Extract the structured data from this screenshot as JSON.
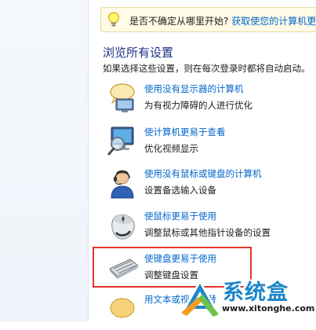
{
  "tip": {
    "text": "是否不确定从哪里开始?",
    "link": "获取使您的计算机更"
  },
  "section": {
    "title": "浏览所有设置",
    "description": "如果选择这些设置，则在每次登录时都将自动启动。"
  },
  "items": [
    {
      "link": "使用没有显示器的计算机",
      "desc": "为有视力障碍的人进行优化",
      "icon": "speech-bubble-monitor-icon"
    },
    {
      "link": "使计算机更易于查看",
      "desc": "优化视频显示",
      "icon": "monitor-magnifier-icon"
    },
    {
      "link": "使用没有鼠标或键盘的计算机",
      "desc": "设置备选输入设备",
      "icon": "headset-user-icon"
    },
    {
      "link": "使鼠标更易于使用",
      "desc": "调整鼠标或其他指针设备的设置",
      "icon": "mouse-icon"
    },
    {
      "link": "使键盘更易于使用",
      "desc": "调整键盘设置",
      "icon": "keyboard-icon"
    },
    {
      "link": "用文本或视觉代替",
      "desc": "",
      "icon": "text-visual-icon"
    }
  ],
  "watermark": {
    "brand": "系统盒",
    "url": "www.xitonghe.com"
  },
  "colors": {
    "link": "#0066cc",
    "title": "#1e3287",
    "highlight": "#e0352e",
    "tip_background": "#fffbe6"
  }
}
